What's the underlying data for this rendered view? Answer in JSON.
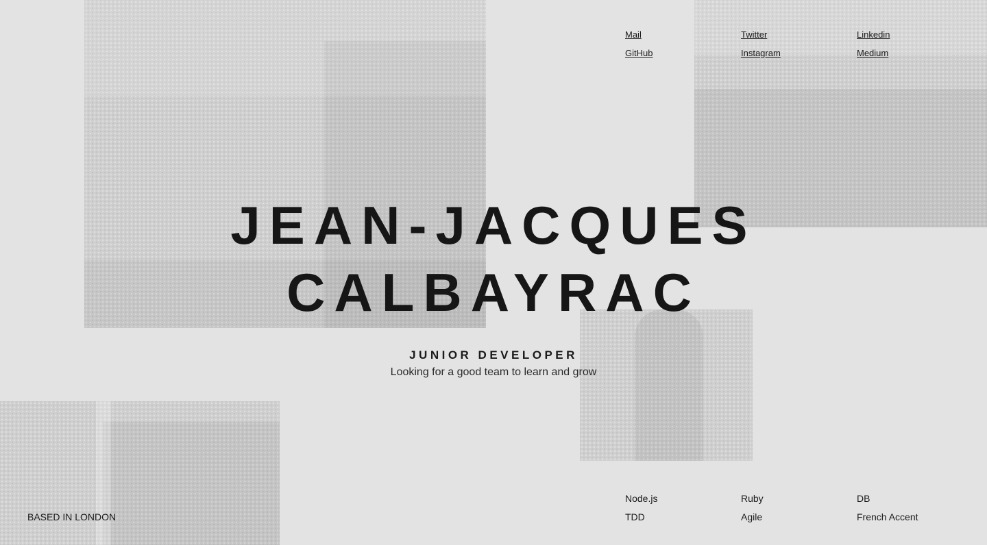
{
  "contact_links": [
    {
      "label": "Mail"
    },
    {
      "label": "Twitter"
    },
    {
      "label": "Linkedin"
    },
    {
      "label": "GitHub"
    },
    {
      "label": "Instagram"
    },
    {
      "label": "Medium"
    }
  ],
  "hero": {
    "name_line1": "JEAN-JACQUES",
    "name_line2": "CALBAYRAC",
    "role": "JUNIOR DEVELOPER",
    "tagline": "Looking for a good team to learn and grow"
  },
  "location": "BASED IN LONDON",
  "skills": [
    "Node.js",
    "Ruby",
    "DB",
    "TDD",
    "Agile",
    "French Accent"
  ],
  "colors": {
    "background": "#e3e3e3",
    "text": "#161616",
    "photo_tint": "#cfcfcf"
  }
}
